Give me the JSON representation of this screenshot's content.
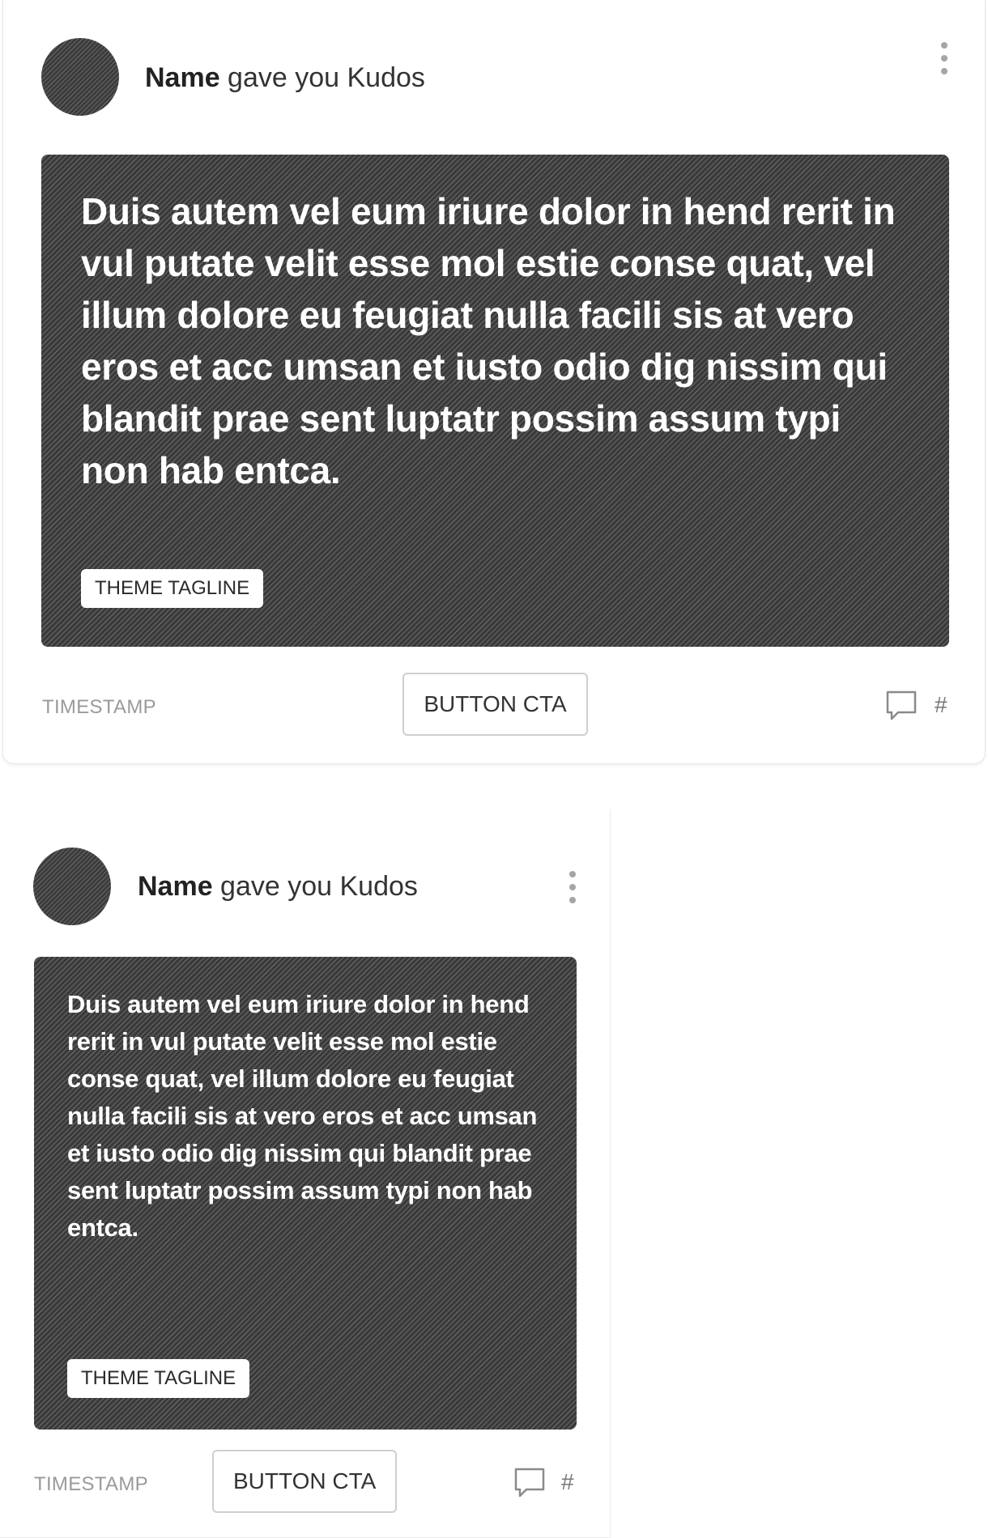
{
  "feed": [
    {
      "author_name": "Name",
      "action_text": " gave you Kudos",
      "message": "Duis autem vel eum iriure dolor in hend rerit in vul putate velit esse mol estie conse quat, vel illum dolore eu feugiat nulla facili sis at vero eros et acc umsan et iusto odio dig nissim qui blandit prae sent luptatr possim assum typi non hab entca.",
      "tagline": "THEME TAGLINE",
      "timestamp": "TIMESTAMP",
      "cta_label": "BUTTON CTA",
      "comment_count": "#",
      "icons": {
        "menu": "kebab-menu-icon",
        "comment": "comment-icon"
      }
    },
    {
      "author_name": "Name",
      "action_text": " gave you Kudos",
      "message": "Duis autem vel eum iriure dolor in hend rerit in vul putate velit esse mol estie conse quat, vel illum dolore eu feugiat nulla facili sis at vero eros et acc umsan et iusto odio dig nissim qui blandit prae sent luptatr possim assum typi non hab entca.",
      "tagline": "THEME TAGLINE",
      "timestamp": "TIMESTAMP",
      "cta_label": "BUTTON CTA",
      "comment_count": "#",
      "icons": {
        "menu": "kebab-menu-icon",
        "comment": "comment-icon"
      }
    }
  ],
  "colors": {
    "hero_background": "#404040",
    "text_primary": "#2b2b2b",
    "text_muted": "#9a9a9a",
    "divider": "#e6e6e6"
  }
}
